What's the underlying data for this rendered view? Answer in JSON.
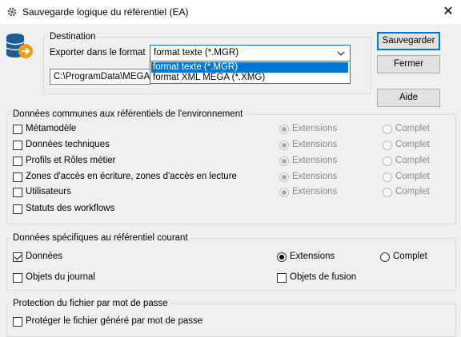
{
  "window": {
    "title": "Sauvegarde logique du référentiel (EA)"
  },
  "destination": {
    "legend": "Destination",
    "export_label": "Exporter dans le format",
    "format_value": "format texte (*.MGR)",
    "options": [
      "format texte (*.MGR)",
      "format XML MEGA (*.XMG)"
    ],
    "path_value": "C:\\ProgramData\\MEGA\\H"
  },
  "buttons": {
    "save": "Sauvegarder",
    "close": "Fermer",
    "help": "Aide"
  },
  "common": {
    "legend": "Données communes aux référentiels de l'environnement",
    "items": [
      {
        "label": "Métamodèle",
        "ext": "Extensions",
        "full": "Complet"
      },
      {
        "label": "Données techniques",
        "ext": "Extensions",
        "full": "Complet"
      },
      {
        "label": "Profils et Rôles métier",
        "ext": "Extensions",
        "full": "Complet"
      },
      {
        "label": "Zones d'accès en écriture, zones d'accès en lecture",
        "ext": "Extensions",
        "full": "Complet"
      },
      {
        "label": "Utilisateurs",
        "ext": "Extensions",
        "full": "Complet"
      },
      {
        "label": "Statuts des workflows"
      }
    ]
  },
  "specific": {
    "legend": "Données spécifiques au référentiel courant",
    "data_label": "Données",
    "ext": "Extensions",
    "full": "Complet",
    "journal_label": "Objets du journal",
    "fusion_label": "Objets de fusion"
  },
  "protection": {
    "legend": "Protection du fichier par mot de passe",
    "protect_label": "Protéger le fichier généré par mot de passe"
  },
  "colors": {
    "accent": "#0078d7",
    "selection": "#0078d7"
  }
}
